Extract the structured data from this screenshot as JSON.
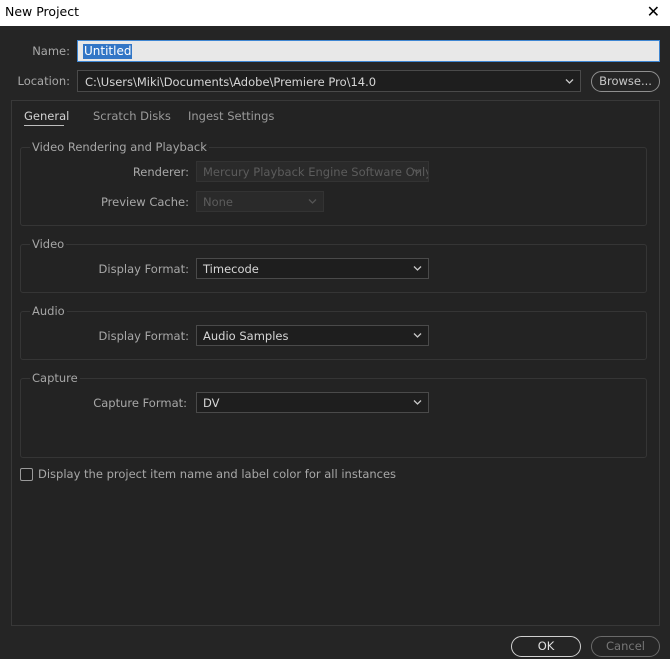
{
  "window": {
    "title": "New Project",
    "close_glyph": "✕"
  },
  "name_field": {
    "label": "Name:",
    "value": "Untitled"
  },
  "location_field": {
    "label": "Location:",
    "value": "C:\\Users\\Miki\\Documents\\Adobe\\Premiere Pro\\14.0",
    "browse_label": "Browse..."
  },
  "tabs": [
    {
      "label": "General",
      "active": true
    },
    {
      "label": "Scratch Disks",
      "active": false
    },
    {
      "label": "Ingest Settings",
      "active": false
    }
  ],
  "video_rendering": {
    "title": "Video Rendering and Playback",
    "renderer_label": "Renderer:",
    "renderer_value": "Mercury Playback Engine Software Only",
    "preview_cache_label": "Preview Cache:",
    "preview_cache_value": "None"
  },
  "video": {
    "title": "Video",
    "display_format_label": "Display Format:",
    "display_format_value": "Timecode"
  },
  "audio": {
    "title": "Audio",
    "display_format_label": "Display Format:",
    "display_format_value": "Audio Samples"
  },
  "capture": {
    "title": "Capture",
    "capture_format_label": "Capture Format:",
    "capture_format_value": "DV"
  },
  "options": {
    "display_label_color_text": "Display the project item name and label color for all instances",
    "display_label_color_checked": false
  },
  "footer": {
    "ok_label": "OK",
    "cancel_label": "Cancel"
  },
  "icons": {
    "chevron": "chevron-down-icon",
    "checkbox": "checkbox-icon"
  },
  "colors": {
    "background": "#252525",
    "selection": "#3276c6",
    "focus_border": "#3e86d2"
  }
}
